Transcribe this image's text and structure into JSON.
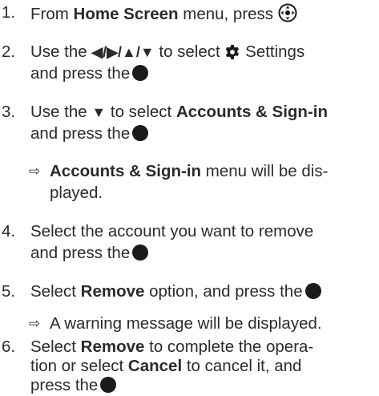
{
  "steps": [
    {
      "num": "1.",
      "l1a": "From ",
      "l1b": "Home Screen",
      "l1c": " menu, press "
    },
    {
      "num": "2.",
      "l1a": "Use the ",
      "arrows": "◀/▶/▲/▼",
      "l1b": " to select ",
      "l1c": " Settings",
      "l2": "and press the"
    },
    {
      "num": "3.",
      "l1a": "Use the ",
      "arrow": "▼",
      "l1b": " to select ",
      "l1c": "Accounts & Sign-in",
      "l2": "and press the"
    },
    {
      "num": "4.",
      "l1": "Select the account you want to remove",
      "l2": "and press the"
    },
    {
      "num": "5.",
      "l1a": "Select ",
      "l1b": "Remove",
      "l1c": " option, and press the"
    },
    {
      "num": "6.",
      "l1a": "Select ",
      "l1b": "Remove",
      "l1c": " to complete the opera-",
      "l2a": "tion or select ",
      "l2b": "Cancel",
      "l2c": " to cancel it, and",
      "l3": "press the"
    }
  ],
  "notes": [
    {
      "arrow": "⇨",
      "l1a": "Accounts & Sign-in",
      "l1b": " menu will be dis-",
      "l2": "played."
    },
    {
      "arrow": "⇨",
      "l1": "A warning message will be displayed."
    }
  ],
  "icons": {
    "navigation": "navigation-pad-icon",
    "settings": "gear-icon",
    "ok": "ok-button-icon"
  }
}
